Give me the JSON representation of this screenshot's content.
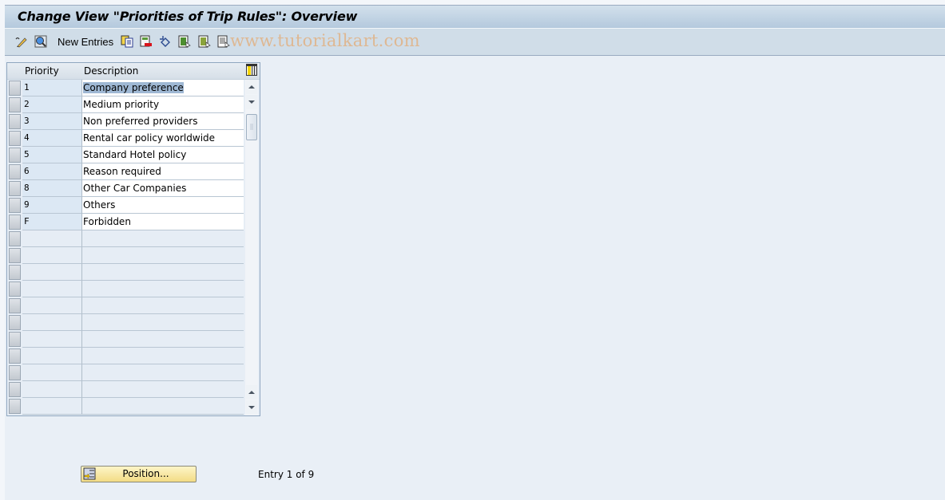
{
  "window": {
    "title": "Change View \"Priorities of Trip Rules\": Overview"
  },
  "toolbar": {
    "items": [
      {
        "icon": "display-change-icon"
      },
      {
        "icon": "details-icon"
      },
      {
        "label": "New Entries"
      },
      {
        "icon": "copy-as-icon"
      },
      {
        "icon": "delete-icon"
      },
      {
        "icon": "undo-change-icon"
      },
      {
        "icon": "select-all-icon"
      },
      {
        "icon": "select-block-icon"
      },
      {
        "icon": "deselect-all-icon"
      }
    ],
    "watermark": "www.tutorialkart.com"
  },
  "table": {
    "columns": [
      "Priority",
      "Description"
    ],
    "rows": [
      {
        "priority": "1",
        "description": "Company preference",
        "selected_text": true
      },
      {
        "priority": "2",
        "description": "Medium priority"
      },
      {
        "priority": "3",
        "description": "Non preferred providers"
      },
      {
        "priority": "4",
        "description": "Rental car policy worldwide"
      },
      {
        "priority": "5",
        "description": "Standard Hotel policy"
      },
      {
        "priority": "6",
        "description": "Reason required"
      },
      {
        "priority": "8",
        "description": "Other Car Companies"
      },
      {
        "priority": "9",
        "description": "Others"
      },
      {
        "priority": "F",
        "description": "Forbidden"
      }
    ],
    "empty_rows": 11
  },
  "footer": {
    "position_button": "Position...",
    "entry_info": "Entry 1 of 9"
  }
}
